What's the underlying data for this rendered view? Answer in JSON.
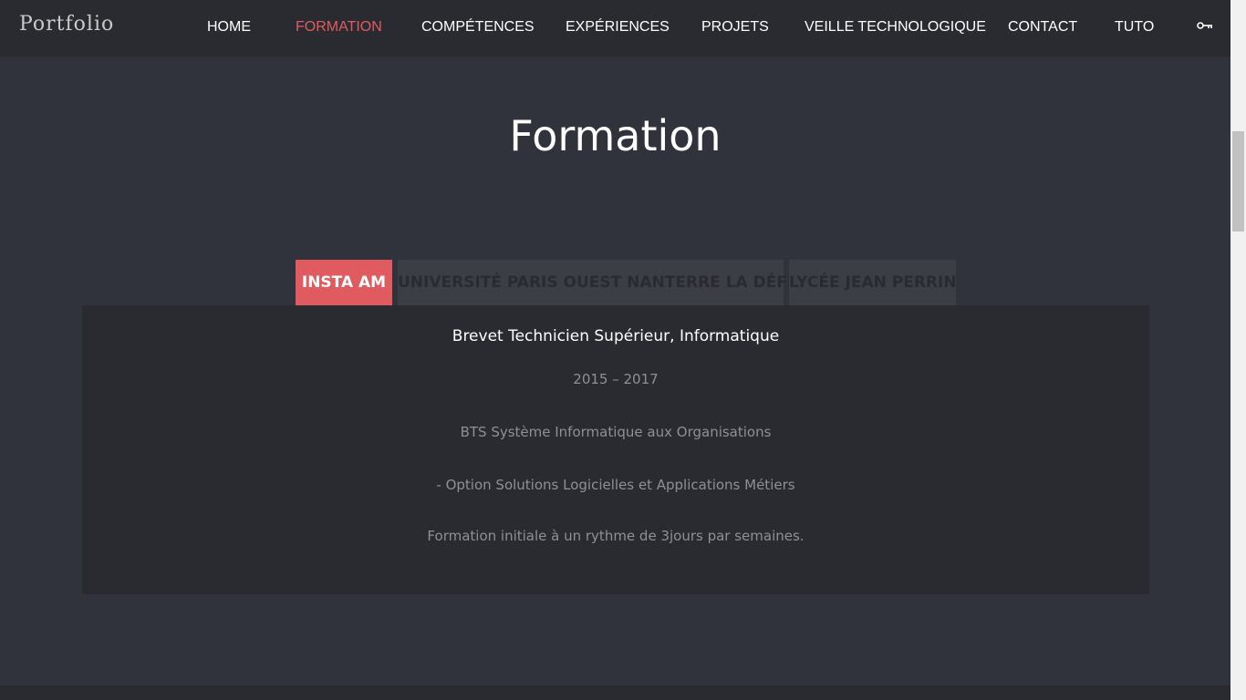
{
  "nav": {
    "brand": "Portfolio",
    "items": [
      {
        "label": "HOME"
      },
      {
        "label": "FORMATION"
      },
      {
        "label": "COMPÉTENCES"
      },
      {
        "label": "EXPÉRIENCES"
      },
      {
        "label": "PROJETS"
      },
      {
        "label": "VEILLE TECHNOLOGIQUE"
      },
      {
        "label": "CONTACT"
      },
      {
        "label": "TUTO"
      }
    ],
    "active_item": "FORMATION",
    "login_icon": "key-icon"
  },
  "main": {
    "title": "Formation",
    "tabs": [
      {
        "label": "INSTA AM",
        "active": true
      },
      {
        "label": "UNIVERSITÉ PARIS OUEST NANTERRE LA DÉFENSE",
        "active": false
      },
      {
        "label": "LYCÉE JEAN PERRIN",
        "active": false
      }
    ],
    "panel": {
      "heading": "Brevet Technicien Supérieur, Informatique",
      "dates": "2015 – 2017",
      "line1": "BTS Système Informatique aux Organisations",
      "line2": "- Option Solutions Logicielles et Applications Métiers",
      "line3": "Formation initiale à un rythme de 3jours par semaines."
    }
  },
  "colors": {
    "accent": "#e05b5f",
    "background": "#30333b",
    "navbar": "#292b30",
    "panel": "#292b30",
    "tab_inactive": "#3c3e45"
  }
}
